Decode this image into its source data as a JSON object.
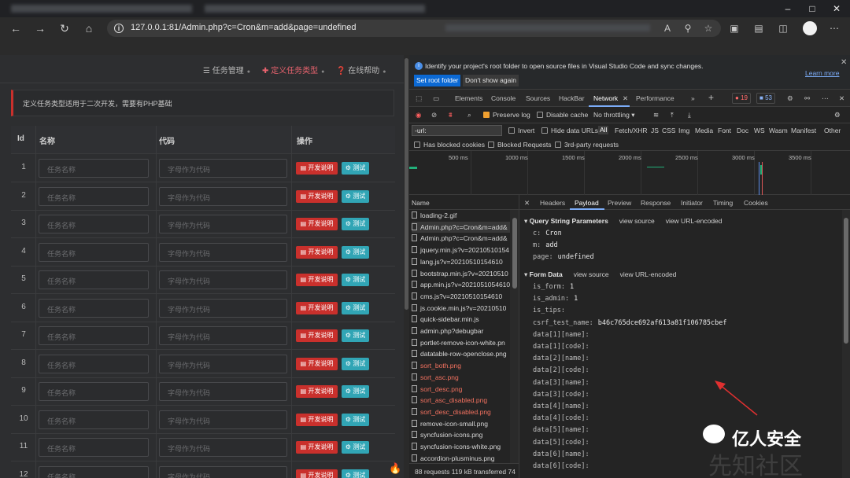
{
  "browser": {
    "url": "127.0.0.1:81/Admin.php?c=Cron&m=add&page=undefined"
  },
  "page": {
    "nav": [
      {
        "label": "任务管理"
      },
      {
        "label": "定义任务类型"
      },
      {
        "label": "在线帮助"
      }
    ],
    "notice": "定义任务类型适用于二次开发，需要有PHP基础",
    "headers": {
      "id": "Id",
      "name": "名称",
      "code": "代码",
      "action": "操作"
    },
    "name_placeholder": "任务名称",
    "code_placeholder": "字母作为代码",
    "dev_label": "开发说明",
    "test_label": "测试",
    "rows": [
      "1",
      "2",
      "3",
      "4",
      "5",
      "6",
      "7",
      "8",
      "9",
      "10",
      "11",
      "12"
    ]
  },
  "devtools": {
    "banner": "Identify your project's root folder to open source files in Visual Studio Code and sync changes.",
    "set_root": "Set root folder",
    "dont_show": "Don't show again",
    "learn_more": "Learn more",
    "tabs": [
      "Elements",
      "Console",
      "Sources",
      "HackBar",
      "Network",
      "Performance"
    ],
    "errors_count": "19",
    "warnings_count": "53",
    "toolbar": {
      "preserve_log": "Preserve log",
      "disable_cache": "Disable cache",
      "throttling": "No throttling"
    },
    "filter_value": "-url:",
    "filters": {
      "invert": "Invert",
      "hide_data": "Hide data URLs",
      "types": [
        "All",
        "Fetch/XHR",
        "JS",
        "CSS",
        "Img",
        "Media",
        "Font",
        "Doc",
        "WS",
        "Wasm",
        "Manifest",
        "Other"
      ]
    },
    "filters2": {
      "blocked_cookies": "Has blocked cookies",
      "blocked_requests": "Blocked Requests",
      "third_party": "3rd-party requests"
    },
    "ticks": [
      "500 ms",
      "1000 ms",
      "1500 ms",
      "2000 ms",
      "2500 ms",
      "3000 ms",
      "3500 ms"
    ],
    "name_header": "Name",
    "requests": [
      {
        "name": "loading-2.gif",
        "err": false,
        "sel": false
      },
      {
        "name": "Admin.php?c=Cron&m=add&",
        "err": false,
        "sel": true
      },
      {
        "name": "Admin.php?c=Cron&m=add&",
        "err": false,
        "sel": false
      },
      {
        "name": "jquery.min.js?v=20210510154",
        "err": false,
        "sel": false
      },
      {
        "name": "lang.js?v=20210510154610",
        "err": false,
        "sel": false
      },
      {
        "name": "bootstrap.min.js?v=20210510",
        "err": false,
        "sel": false
      },
      {
        "name": "app.min.js?v=2021051054610",
        "err": false,
        "sel": false
      },
      {
        "name": "cms.js?v=20210510154610",
        "err": false,
        "sel": false
      },
      {
        "name": "js.cookie.min.js?v=20210510",
        "err": false,
        "sel": false
      },
      {
        "name": "quick-sidebar.min.js",
        "err": false,
        "sel": false
      },
      {
        "name": "admin.php?debugbar",
        "err": false,
        "sel": false
      },
      {
        "name": "portlet-remove-icon-white.pn",
        "err": false,
        "sel": false
      },
      {
        "name": "datatable-row-openclose.png",
        "err": false,
        "sel": false
      },
      {
        "name": "sort_both.png",
        "err": true,
        "sel": false
      },
      {
        "name": "sort_asc.png",
        "err": true,
        "sel": false
      },
      {
        "name": "sort_desc.png",
        "err": true,
        "sel": false
      },
      {
        "name": "sort_asc_disabled.png",
        "err": true,
        "sel": false
      },
      {
        "name": "sort_desc_disabled.png",
        "err": true,
        "sel": false
      },
      {
        "name": "remove-icon-small.png",
        "err": false,
        "sel": false
      },
      {
        "name": "syncfusion-icons.png",
        "err": false,
        "sel": false
      },
      {
        "name": "syncfusion-icons-white.png",
        "err": false,
        "sel": false
      },
      {
        "name": "accordion-plusminus.png",
        "err": false,
        "sel": false
      }
    ],
    "status": "88 requests   119 kB transferred   74",
    "detail_tabs": [
      "Headers",
      "Payload",
      "Preview",
      "Response",
      "Initiator",
      "Timing",
      "Cookies"
    ],
    "query_title": "Query String Parameters",
    "form_title": "Form Data",
    "view_source": "view source",
    "view_url": "view URL-encoded",
    "query": [
      {
        "k": "c:",
        "v": "Cron"
      },
      {
        "k": "m:",
        "v": "add"
      },
      {
        "k": "page:",
        "v": "undefined"
      }
    ],
    "form": [
      {
        "k": "is_form:",
        "v": "1"
      },
      {
        "k": "is_admin:",
        "v": "1"
      },
      {
        "k": "is_tips:",
        "v": ""
      },
      {
        "k": "csrf_test_name:",
        "v": "b46c765dce692af613a81f106785cbef"
      },
      {
        "k": "data[1][name]:",
        "v": ""
      },
      {
        "k": "data[1][code]:",
        "v": ""
      },
      {
        "k": "data[2][name]:",
        "v": ""
      },
      {
        "k": "data[2][code]:",
        "v": ""
      },
      {
        "k": "data[3][name]:",
        "v": ""
      },
      {
        "k": "data[3][code]:",
        "v": ""
      },
      {
        "k": "data[4][name]:",
        "v": ""
      },
      {
        "k": "data[4][code]:",
        "v": ""
      },
      {
        "k": "data[5][name]:",
        "v": ""
      },
      {
        "k": "data[5][code]:",
        "v": ""
      },
      {
        "k": "data[6][name]:",
        "v": ""
      },
      {
        "k": "data[6][code]:",
        "v": ""
      }
    ]
  },
  "watermark": {
    "text": "亿人安全",
    "text2": "先知社区"
  }
}
